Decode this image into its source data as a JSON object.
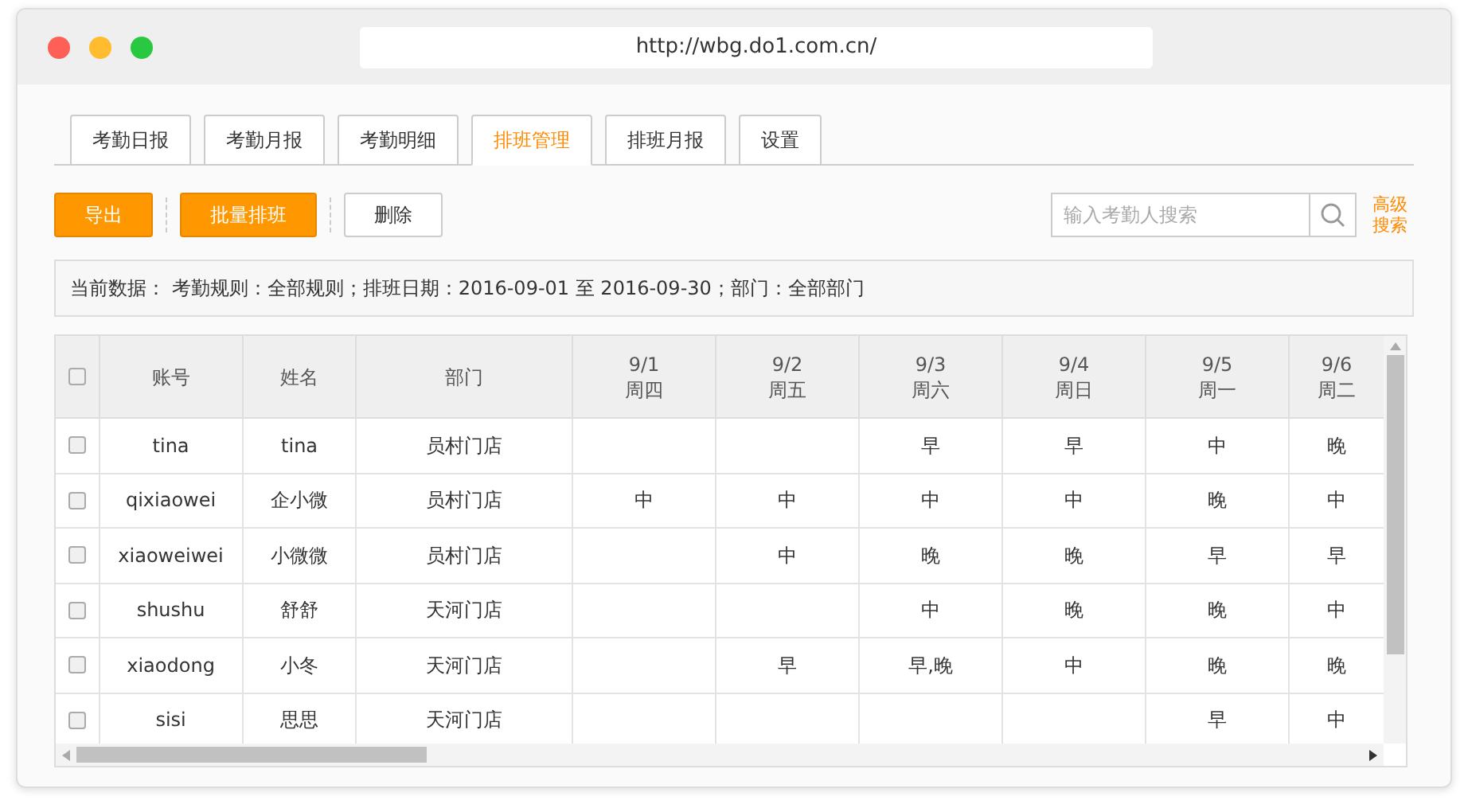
{
  "browser": {
    "url": "http://wbg.do1.com.cn/"
  },
  "tabs": [
    {
      "label": "考勤日报",
      "selected": false
    },
    {
      "label": "考勤月报",
      "selected": false
    },
    {
      "label": "考勤明细",
      "selected": false
    },
    {
      "label": "排班管理",
      "selected": true
    },
    {
      "label": "排班月报",
      "selected": false
    },
    {
      "label": "设置",
      "selected": false
    }
  ],
  "toolbar": {
    "buttons": [
      {
        "label": "导出",
        "kind": "primary"
      },
      {
        "label": "批量排班",
        "kind": "primary"
      },
      {
        "label": "删除",
        "kind": "secondary"
      }
    ],
    "search": {
      "placeholder": "输入考勤人搜索"
    },
    "advanced_search": "高级搜索"
  },
  "filter_summary": "当前数据： 考勤规则：全部规则；排班日期：2016-09-01 至 2016-09-30；部门：全部部门",
  "table": {
    "select_all": {
      "checked": false
    },
    "columns": [
      "账号",
      "姓名",
      "部门"
    ],
    "dates": [
      {
        "date": "9/1",
        "weekday": "周四"
      },
      {
        "date": "9/2",
        "weekday": "周五"
      },
      {
        "date": "9/3",
        "weekday": "周六"
      },
      {
        "date": "9/4",
        "weekday": "周日"
      },
      {
        "date": "9/5",
        "weekday": "周一"
      },
      {
        "date": "9/6",
        "weekday": "周二"
      }
    ],
    "rows": [
      {
        "checked": false,
        "account": "tina",
        "name": "tina",
        "department": "员村门店",
        "shifts": {
          "day_3": "早",
          "day_4": "早",
          "day_5": "中",
          "day_6": "晚"
        }
      },
      {
        "checked": false,
        "account": "qixiaowei",
        "name": "企小微",
        "department": "员村门店",
        "shifts": {
          "day_1": "中",
          "day_2": "中",
          "day_3": "中",
          "day_4": "中",
          "day_5": "晚",
          "day_6": "中"
        }
      },
      {
        "checked": false,
        "account": "xiaoweiwei",
        "name": "小微微",
        "department": "员村门店",
        "shifts": {
          "day_2": "中",
          "day_3": "晚",
          "day_4": "晚",
          "day_5": "早",
          "day_6": "早"
        }
      },
      {
        "checked": false,
        "account": "shushu",
        "name": "舒舒",
        "department": "天河门店",
        "shifts": {
          "day_3": "中",
          "day_4": "晚",
          "day_5": "晚",
          "day_6": "中"
        }
      },
      {
        "checked": false,
        "account": "xiaodong",
        "name": "小冬",
        "department": "天河门店",
        "shifts": {
          "day_2": "早",
          "day_3": "早,晚",
          "day_4": "中",
          "day_5": "晚",
          "day_6": "晚"
        }
      },
      {
        "checked": false,
        "account": "sisi",
        "name": "思思",
        "department": "天河门店",
        "shifts": {
          "day_5": "早",
          "day_6": "中"
        }
      }
    ]
  }
}
